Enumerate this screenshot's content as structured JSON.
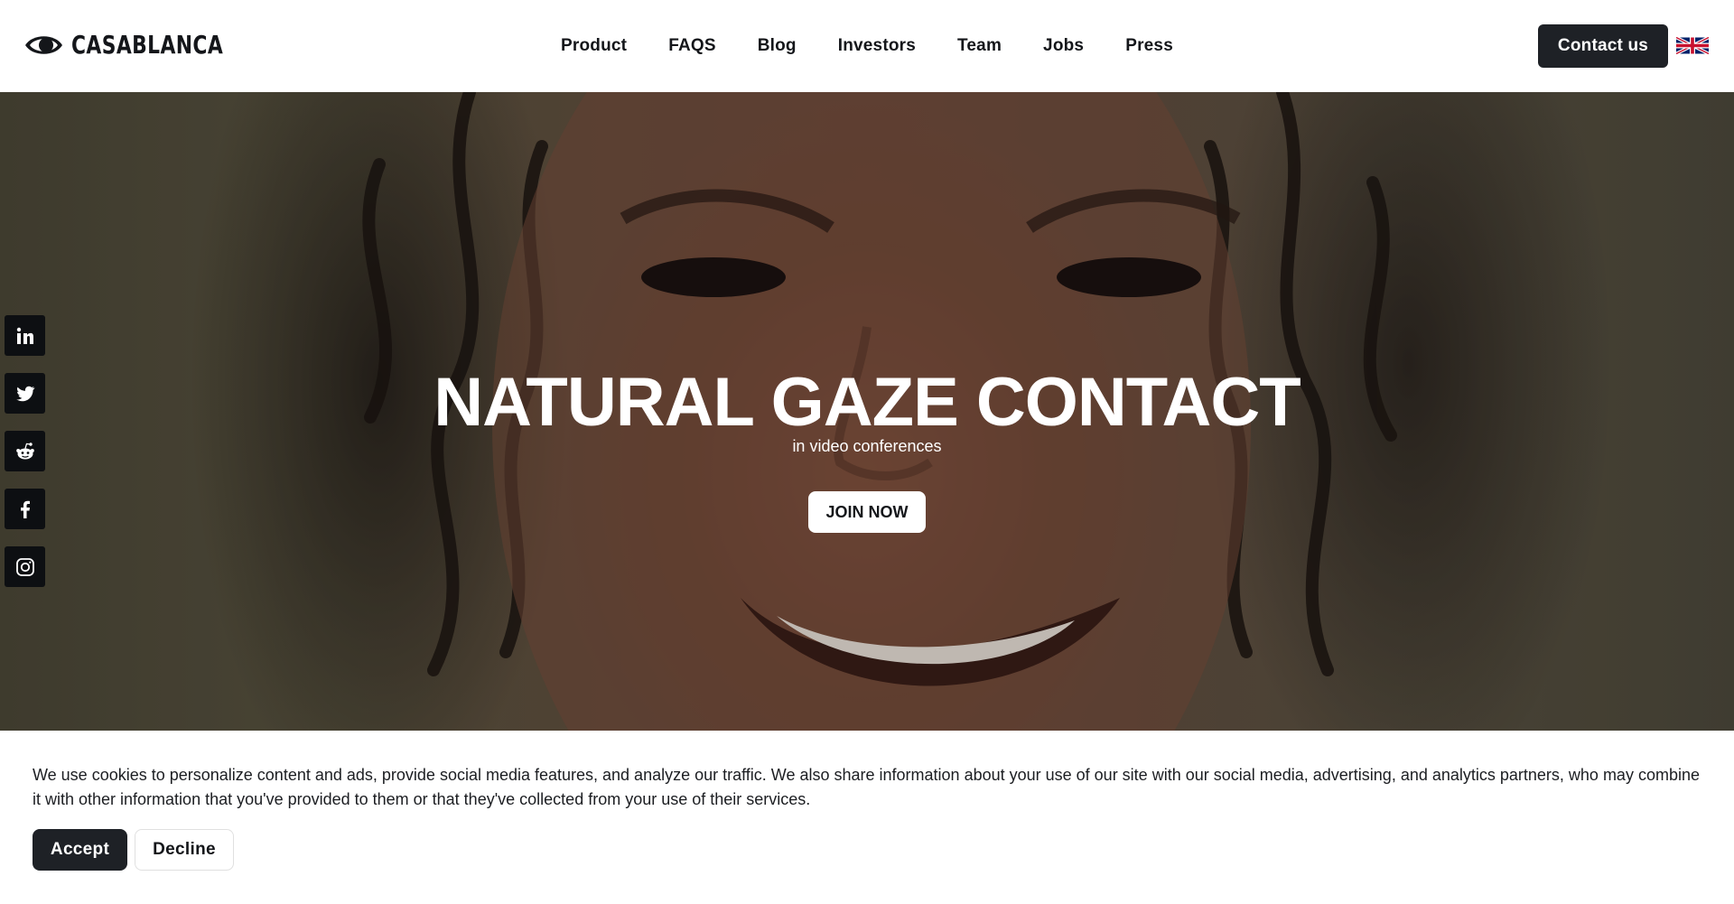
{
  "header": {
    "logo_text": "CASABLANCA",
    "logo_icon": "eye-icon",
    "nav": [
      {
        "label": "Product"
      },
      {
        "label": "FAQS"
      },
      {
        "label": "Blog"
      },
      {
        "label": "Investors"
      },
      {
        "label": "Team"
      },
      {
        "label": "Jobs"
      },
      {
        "label": "Press"
      }
    ],
    "contact_label": "Contact us",
    "language_icon": "uk-flag-icon"
  },
  "hero": {
    "title": "NATURAL GAZE CONTACT",
    "subtitle": "in video conferences",
    "cta_label": "JOIN NOW"
  },
  "social": [
    {
      "icon": "linkedin-icon"
    },
    {
      "icon": "twitter-icon"
    },
    {
      "icon": "reddit-icon"
    },
    {
      "icon": "facebook-icon"
    },
    {
      "icon": "instagram-icon"
    }
  ],
  "cookie_banner": {
    "text": "We use cookies to personalize content and ads, provide social media features, and analyze our traffic. We also share information about your use of our site with our social media, advertising, and analytics partners, who may combine it with other information that you've provided to them or that they've collected from your use of their services.",
    "accept_label": "Accept",
    "decline_label": "Decline"
  },
  "colors": {
    "dark_button": "#1e2126",
    "text": "#14161a",
    "background": "#ffffff"
  }
}
